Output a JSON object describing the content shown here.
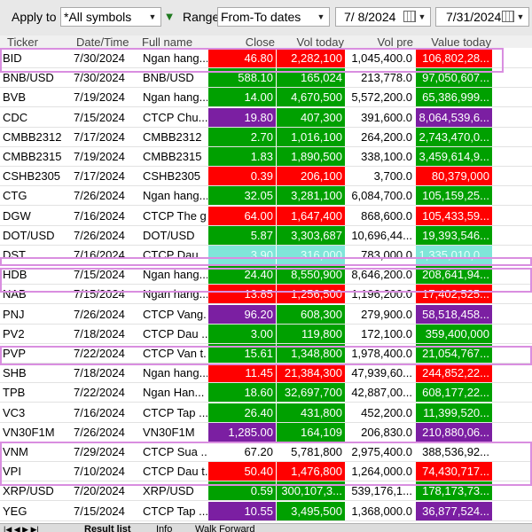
{
  "toolbar": {
    "apply_to_label": "Apply to",
    "apply_to_value": "*All symbols",
    "range_label": "Range",
    "range_value": "From-To dates",
    "from_date": "7/ 8/2024",
    "to_date": "7/31/2024"
  },
  "columns": [
    "Ticker",
    "Date/Time",
    "Full name",
    "Close",
    "Vol today",
    "Vol pre",
    "Value today"
  ],
  "colors": {
    "red": "#ff0000",
    "green": "#00a000",
    "purple": "#7b1fa2",
    "light_green": "#44cc88",
    "cyan": "#7fe6d9",
    "highlight": "#d98ee0"
  },
  "rows": [
    {
      "ticker": "BID",
      "date": "7/30/2024",
      "name": "Ngan hang...",
      "close": "46.80",
      "vol_today": "2,282,100",
      "vol_pre": "1,045,400.0",
      "value_today": "106,802,28...",
      "close_color": "red",
      "vol_color": "red",
      "value_color": "red"
    },
    {
      "ticker": "BNB/USD",
      "date": "7/30/2024",
      "name": "BNB/USD",
      "close": "588.10",
      "vol_today": "165,024",
      "vol_pre": "213,778.0",
      "value_today": "97,050,607...",
      "close_color": "green",
      "vol_color": "green",
      "value_color": "green"
    },
    {
      "ticker": "BVB",
      "date": "7/19/2024",
      "name": "Ngan hang...",
      "close": "14.00",
      "vol_today": "4,670,500",
      "vol_pre": "5,572,200.0",
      "value_today": "65,386,999...",
      "close_color": "green",
      "vol_color": "green",
      "value_color": "green"
    },
    {
      "ticker": "CDC",
      "date": "7/15/2024",
      "name": "CTCP Chu...",
      "close": "19.80",
      "vol_today": "407,300",
      "vol_pre": "391,600.0",
      "value_today": "8,064,539,6...",
      "close_color": "purple",
      "vol_color": "green",
      "value_color": "purple"
    },
    {
      "ticker": "CMBB2312",
      "date": "7/17/2024",
      "name": "CMBB2312",
      "close": "2.70",
      "vol_today": "1,016,100",
      "vol_pre": "264,200.0",
      "value_today": "2,743,470,0...",
      "close_color": "green",
      "vol_color": "green",
      "value_color": "green"
    },
    {
      "ticker": "CMBB2315",
      "date": "7/19/2024",
      "name": "CMBB2315",
      "close": "1.83",
      "vol_today": "1,890,500",
      "vol_pre": "338,100.0",
      "value_today": "3,459,614,9...",
      "close_color": "green",
      "vol_color": "green",
      "value_color": "green"
    },
    {
      "ticker": "CSHB2305",
      "date": "7/17/2024",
      "name": "CSHB2305",
      "close": "0.39",
      "vol_today": "206,100",
      "vol_pre": "3,700.0",
      "value_today": "80,379,000",
      "close_color": "red",
      "vol_color": "red",
      "value_color": "red"
    },
    {
      "ticker": "CTG",
      "date": "7/26/2024",
      "name": "Ngan hang...",
      "close": "32.05",
      "vol_today": "3,281,100",
      "vol_pre": "6,084,700.0",
      "value_today": "105,159,25...",
      "close_color": "green",
      "vol_color": "green",
      "value_color": "green"
    },
    {
      "ticker": "DGW",
      "date": "7/16/2024",
      "name": "CTCP The g...",
      "close": "64.00",
      "vol_today": "1,647,400",
      "vol_pre": "868,600.0",
      "value_today": "105,433,59...",
      "close_color": "red",
      "vol_color": "red",
      "value_color": "red"
    },
    {
      "ticker": "DOT/USD",
      "date": "7/26/2024",
      "name": "DOT/USD",
      "close": "5.87",
      "vol_today": "3,303,687",
      "vol_pre": "10,696,44...",
      "value_today": "19,393,546...",
      "close_color": "green",
      "vol_color": "green",
      "value_color": "green"
    },
    {
      "ticker": "DST",
      "date": "7/16/2024",
      "name": "CTCP Dau ...",
      "close": "3.90",
      "vol_today": "316,000",
      "vol_pre": "783,000.0",
      "value_today": "1,335,010,0...",
      "close_color": "cyan",
      "vol_color": "cyan",
      "value_color": "cyan"
    },
    {
      "ticker": "HDB",
      "date": "7/15/2024",
      "name": "Ngan hang...",
      "close": "24.40",
      "vol_today": "8,550,900",
      "vol_pre": "8,646,200.0",
      "value_today": "208,641,94...",
      "close_color": "green",
      "vol_color": "green",
      "value_color": "green"
    },
    {
      "ticker": "NAB",
      "date": "7/15/2024",
      "name": "Ngan hang...",
      "close": "13.85",
      "vol_today": "1,256,500",
      "vol_pre": "1,196,200.0",
      "value_today": "17,402,525...",
      "close_color": "red",
      "vol_color": "red",
      "value_color": "red"
    },
    {
      "ticker": "PNJ",
      "date": "7/26/2024",
      "name": "CTCP Vang...",
      "close": "96.20",
      "vol_today": "608,300",
      "vol_pre": "279,900.0",
      "value_today": "58,518,458...",
      "close_color": "purple",
      "vol_color": "green",
      "value_color": "purple"
    },
    {
      "ticker": "PV2",
      "date": "7/18/2024",
      "name": "CTCP Dau ...",
      "close": "3.00",
      "vol_today": "119,800",
      "vol_pre": "172,100.0",
      "value_today": "359,400,000",
      "close_color": "green",
      "vol_color": "green",
      "value_color": "green"
    },
    {
      "ticker": "PVP",
      "date": "7/22/2024",
      "name": "CTCP Van t...",
      "close": "15.61",
      "vol_today": "1,348,800",
      "vol_pre": "1,978,400.0",
      "value_today": "21,054,767...",
      "close_color": "green",
      "vol_color": "green",
      "value_color": "green"
    },
    {
      "ticker": "SHB",
      "date": "7/18/2024",
      "name": "Ngan hang...",
      "close": "11.45",
      "vol_today": "21,384,300",
      "vol_pre": "47,939,60...",
      "value_today": "244,852,22...",
      "close_color": "red",
      "vol_color": "red",
      "value_color": "red"
    },
    {
      "ticker": "TPB",
      "date": "7/22/2024",
      "name": "Ngan Han...",
      "close": "18.60",
      "vol_today": "32,697,700",
      "vol_pre": "42,887,00...",
      "value_today": "608,177,22...",
      "close_color": "green",
      "vol_color": "green",
      "value_color": "green"
    },
    {
      "ticker": "VC3",
      "date": "7/16/2024",
      "name": "CTCP Tap ...",
      "close": "26.40",
      "vol_today": "431,800",
      "vol_pre": "452,200.0",
      "value_today": "11,399,520...",
      "close_color": "green",
      "vol_color": "green",
      "value_color": "green"
    },
    {
      "ticker": "VN30F1M",
      "date": "7/26/2024",
      "name": "VN30F1M",
      "close": "1,285.00",
      "vol_today": "164,109",
      "vol_pre": "206,830.0",
      "value_today": "210,880,06...",
      "close_color": "purple",
      "vol_color": "green",
      "value_color": "purple"
    },
    {
      "ticker": "VNM",
      "date": "7/29/2024",
      "name": "CTCP Sua ...",
      "close": "67.20",
      "vol_today": "5,781,800",
      "vol_pre": "2,975,400.0",
      "value_today": "388,536,92...",
      "close_color": "none",
      "vol_color": "none",
      "value_color": "none"
    },
    {
      "ticker": "VPI",
      "date": "7/10/2024",
      "name": "CTCP Dau t...",
      "close": "50.40",
      "vol_today": "1,476,800",
      "vol_pre": "1,264,000.0",
      "value_today": "74,430,717...",
      "close_color": "red",
      "vol_color": "red",
      "value_color": "red"
    },
    {
      "ticker": "XRP/USD",
      "date": "7/20/2024",
      "name": "XRP/USD",
      "close": "0.59",
      "vol_today": "300,107,3...",
      "vol_pre": "539,176,1...",
      "value_today": "178,173,73...",
      "close_color": "green",
      "vol_color": "green",
      "value_color": "green"
    },
    {
      "ticker": "YEG",
      "date": "7/15/2024",
      "name": "CTCP Tap ...",
      "close": "10.55",
      "vol_today": "3,495,500",
      "vol_pre": "1,368,000.0",
      "value_today": "36,877,524...",
      "close_color": "purple",
      "vol_color": "green",
      "value_color": "purple"
    }
  ],
  "tabs": [
    "Result list",
    "Info",
    "Walk Forward"
  ]
}
